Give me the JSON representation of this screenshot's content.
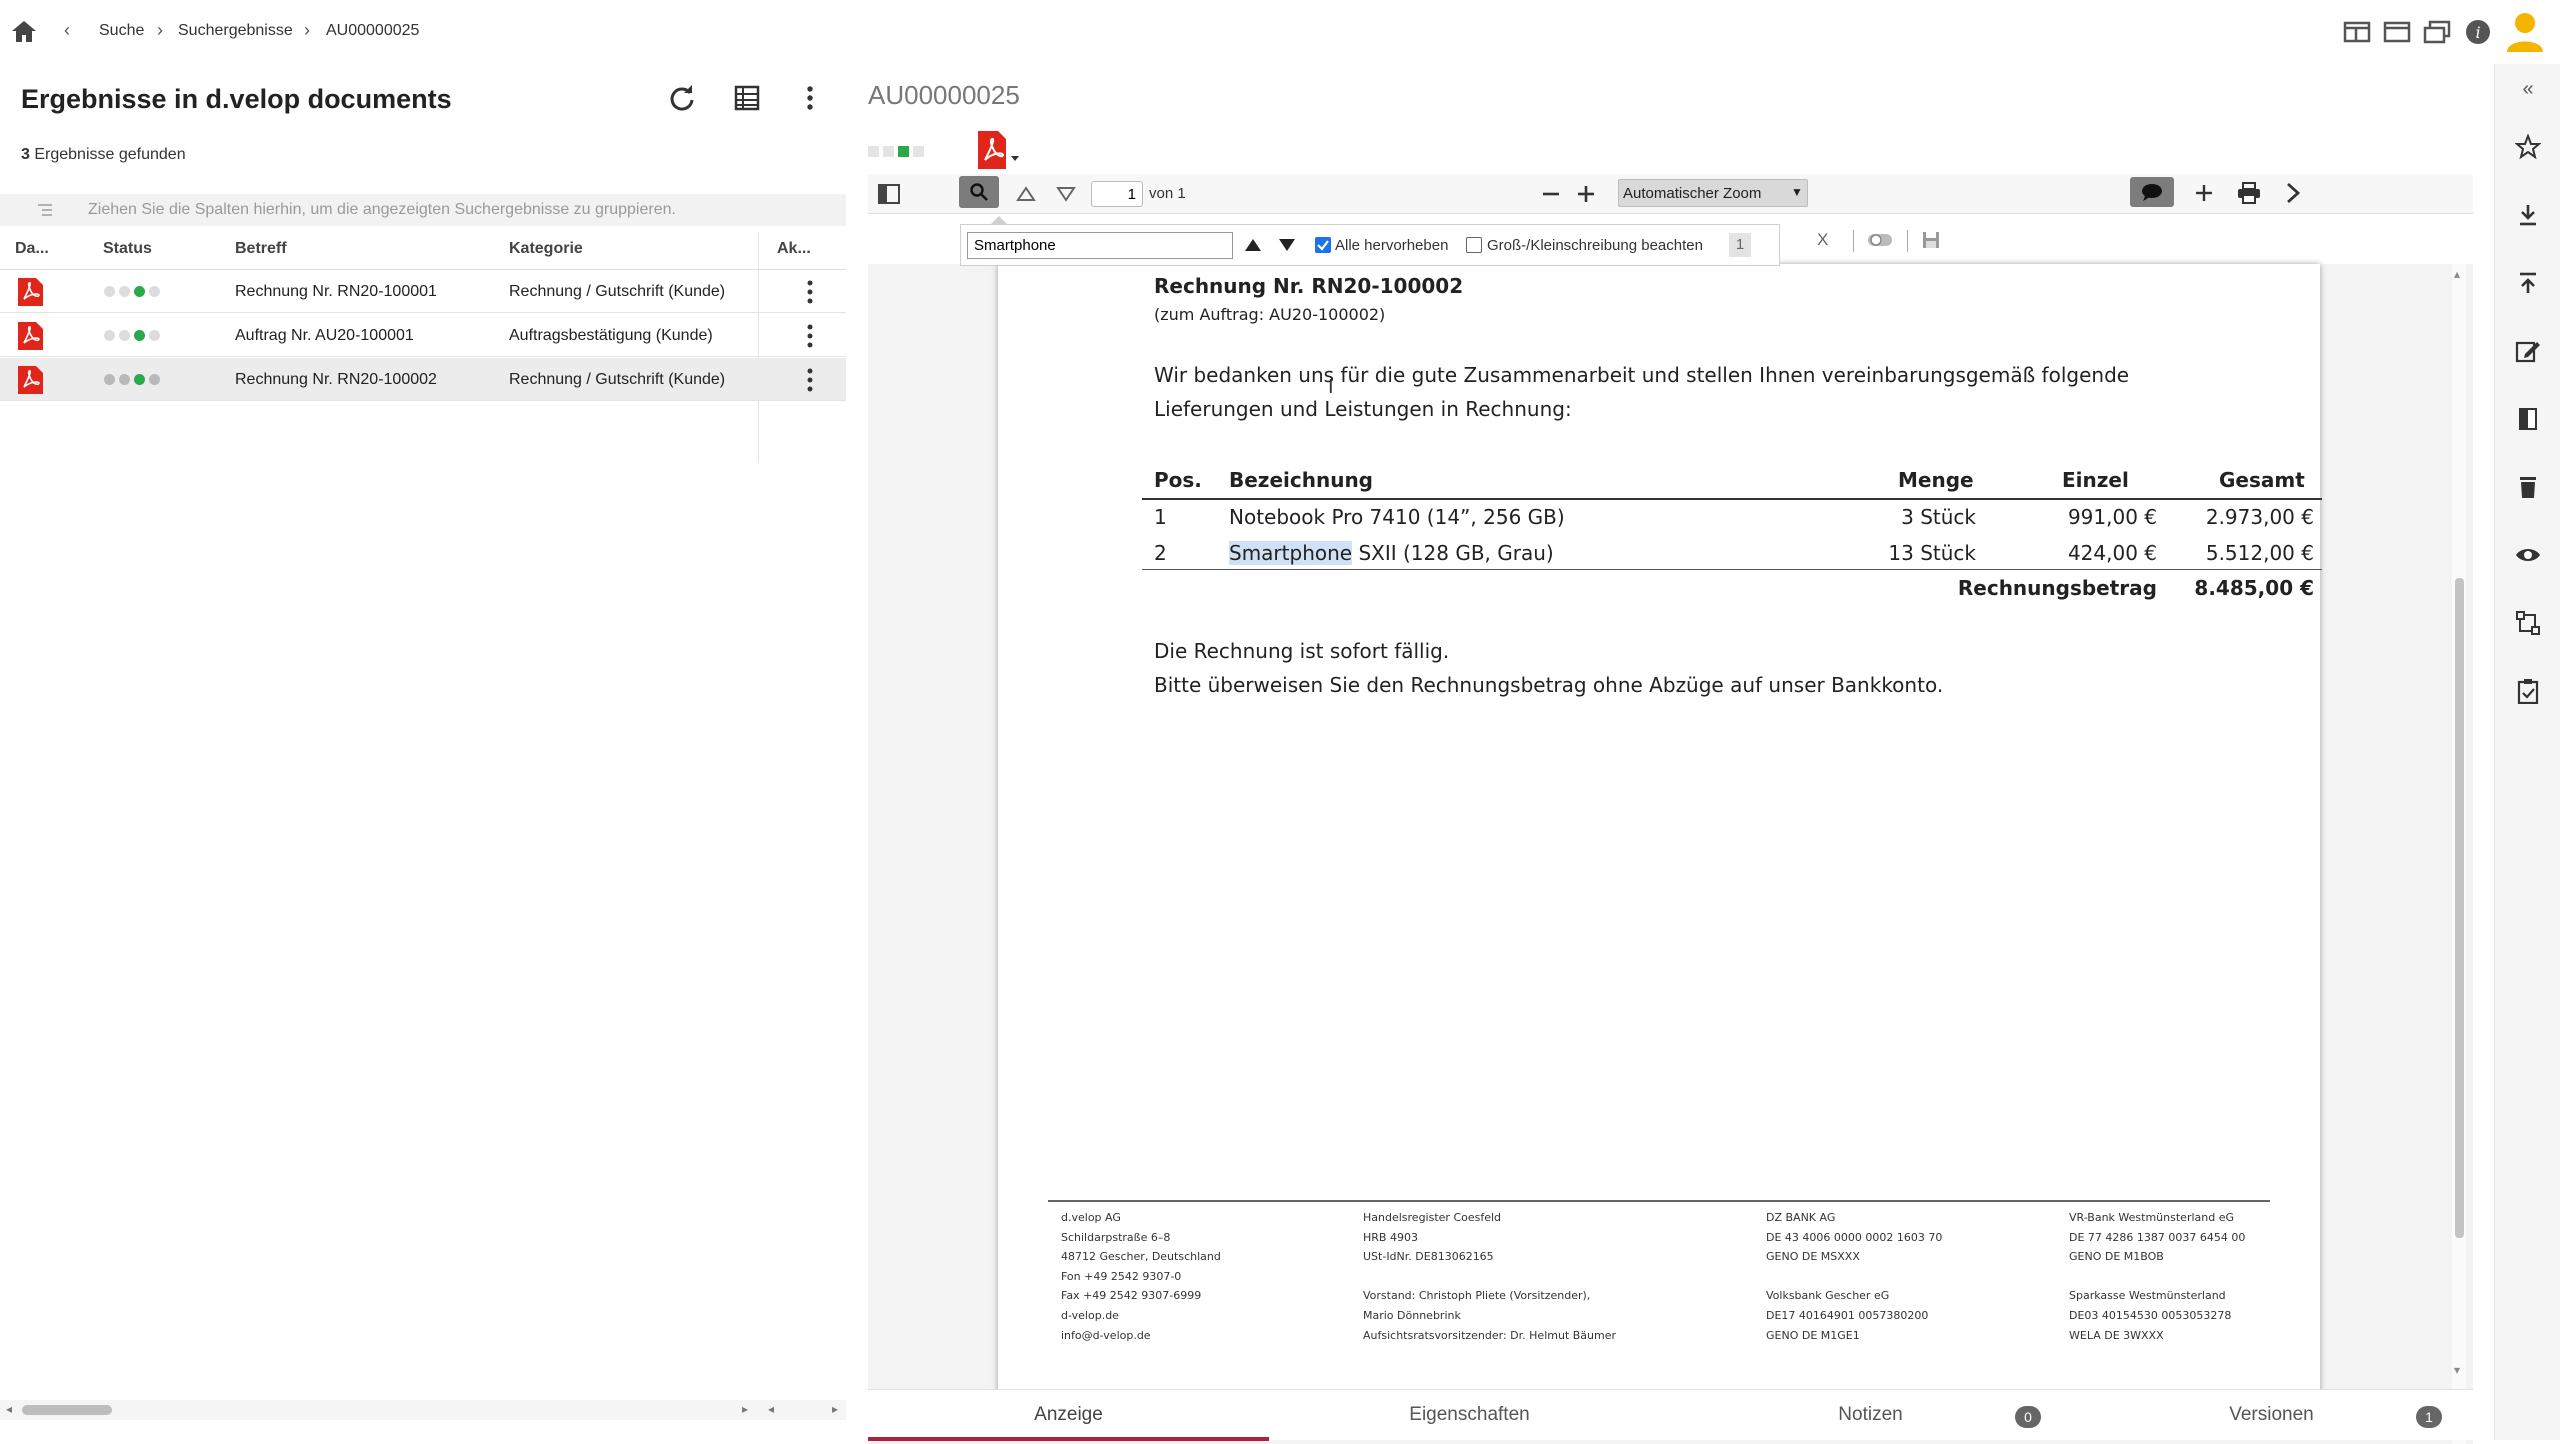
{
  "breadcrumb": {
    "items": [
      "Suche",
      "Suchergebnisse",
      "AU00000025"
    ]
  },
  "left": {
    "title": "Ergebnisse in d.velop documents",
    "count_num": "3",
    "count_label": "Ergebnisse gefunden",
    "group_hint": "Ziehen Sie die Spalten hierhin, um die angezeigten Suchergebnisse zu gruppieren.",
    "columns": [
      "Da...",
      "Status",
      "Betreff",
      "Kategorie",
      "Ak..."
    ],
    "rows": [
      {
        "betreff": "Rechnung Nr. RN20-100001",
        "kategorie": "Rechnung / Gutschrift (Kunde)",
        "status_active": 3,
        "selected": false
      },
      {
        "betreff": "Auftrag Nr. AU20-100001",
        "kategorie": "Auftragsbestätigung (Kunde)",
        "status_active": 3,
        "selected": false
      },
      {
        "betreff": "Rechnung Nr. RN20-100002",
        "kategorie": "Rechnung / Gutschrift (Kunde)",
        "status_active": 3,
        "selected": true
      }
    ]
  },
  "viewer": {
    "doc_title": "AU00000025",
    "page_current": "1",
    "page_of": "von 1",
    "zoom": "Automatischer Zoom",
    "find": {
      "value": "Smartphone",
      "highlight_all": "Alle hervorheben",
      "match_case": "Groß-/Kleinschreibung beachten",
      "count": "1",
      "close": "X"
    }
  },
  "document": {
    "title": "Rechnung Nr. RN20-100002",
    "subtitle": "(zum Auftrag: AU20-100002)",
    "intro": "Wir bedanken uns für die gute Zusammenarbeit und stellen Ihnen vereinbarungsgemäß folgende Lieferungen und Leistungen in Rechnung:",
    "table_headers": [
      "Pos.",
      "Bezeichnung",
      "Menge",
      "Einzel",
      "Gesamt"
    ],
    "items": [
      {
        "pos": "1",
        "name_hl": "",
        "name_rest": "Notebook Pro 7410 (14”, 256 GB)",
        "menge": "3 Stück",
        "einzel": "991,00 €",
        "gesamt": "2.973,00 €"
      },
      {
        "pos": "2",
        "name_hl": "Smartphone",
        "name_rest": " SXII (128 GB, Grau)",
        "menge": "13 Stück",
        "einzel": "424,00 €",
        "gesamt": "5.512,00 €"
      }
    ],
    "total_label": "Rechnungsbetrag",
    "total_value": "8.485,00 €",
    "closing_1": "Die Rechnung ist sofort fällig.",
    "closing_2": "Bitte überweisen Sie den Rechnungsbetrag ohne Abzüge auf unser Bankkonto.",
    "footer": [
      "d.velop AG\nSchildarpstraße 6–8\n48712 Gescher, Deutschland\nFon   +49 2542 9307-0\nFax   +49 2542 9307-6999\nd-velop.de\ninfo@d-velop.de",
      "Handelsregister Coesfeld\nHRB 4903\nUSt-IdNr. DE813062165\n\nVorstand: Christoph Pliete (Vorsitzender),\nMario Dönnebrink\nAufsichtsratsvorsitzender: Dr. Helmut Bäumer",
      "DZ BANK AG\nDE 43 4006 0000 0002 1603 70\nGENO DE MSXXX\n\nVolksbank Gescher eG\nDE17 40164901 0057380200\nGENO DE M1GE1",
      "VR-Bank Westmünsterland eG\nDE 77 4286 1387 0037 6454 00\nGENO DE M1BOB\n\nSparkasse Westmünsterland\nDE03 40154530 0053053278\nWELA DE 3WXXX"
    ]
  },
  "tabs": [
    {
      "label": "Anzeige",
      "badge": ""
    },
    {
      "label": "Eigenschaften",
      "badge": ""
    },
    {
      "label": "Notizen",
      "badge": "0"
    },
    {
      "label": "Versionen",
      "badge": "1"
    }
  ],
  "colors": {
    "accent": "#a8233b",
    "status_green": "#2aa84a",
    "pdf_red": "#e0261b",
    "avatar": "#f5b400"
  }
}
